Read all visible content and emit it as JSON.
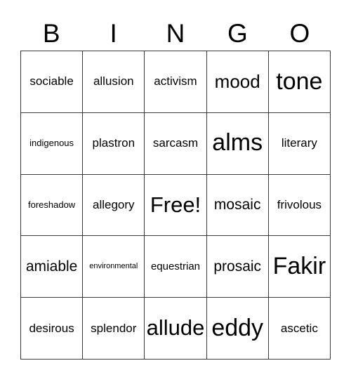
{
  "card": {
    "title": "BINGO",
    "header_letters": [
      "B",
      "I",
      "N",
      "G",
      "O"
    ],
    "free_space_label": "Free!",
    "colors": {
      "background": "#ffffff",
      "cell_background": "#ffffff",
      "border": "#3a3a3a",
      "text": "#000000"
    },
    "grid": {
      "columns": 5,
      "rows": 5,
      "rows_data": [
        [
          {
            "word": "sociable",
            "size": "m"
          },
          {
            "word": "allusion",
            "size": "m"
          },
          {
            "word": "activism",
            "size": "m"
          },
          {
            "word": "mood",
            "size": "xl"
          },
          {
            "word": "tone",
            "size": "huge"
          }
        ],
        [
          {
            "word": "indigenous",
            "size": "xs"
          },
          {
            "word": "plastron",
            "size": "m"
          },
          {
            "word": "sarcasm",
            "size": "m"
          },
          {
            "word": "alms",
            "size": "huge"
          },
          {
            "word": "literary",
            "size": "m"
          }
        ],
        [
          {
            "word": "foreshadow",
            "size": "xs"
          },
          {
            "word": "allegory",
            "size": "m"
          },
          {
            "word": "Free!",
            "size": "xxl"
          },
          {
            "word": "mosaic",
            "size": "l"
          },
          {
            "word": "frivolous",
            "size": "m"
          }
        ],
        [
          {
            "word": "amiable",
            "size": "l"
          },
          {
            "word": "environmental",
            "size": "xxs"
          },
          {
            "word": "equestrian",
            "size": "s"
          },
          {
            "word": "prosaic",
            "size": "l"
          },
          {
            "word": "Fakir",
            "size": "huge"
          }
        ],
        [
          {
            "word": "desirous",
            "size": "m"
          },
          {
            "word": "splendor",
            "size": "m"
          },
          {
            "word": "allude",
            "size": "xxl"
          },
          {
            "word": "eddy",
            "size": "huge"
          },
          {
            "word": "ascetic",
            "size": "m"
          }
        ]
      ]
    }
  }
}
